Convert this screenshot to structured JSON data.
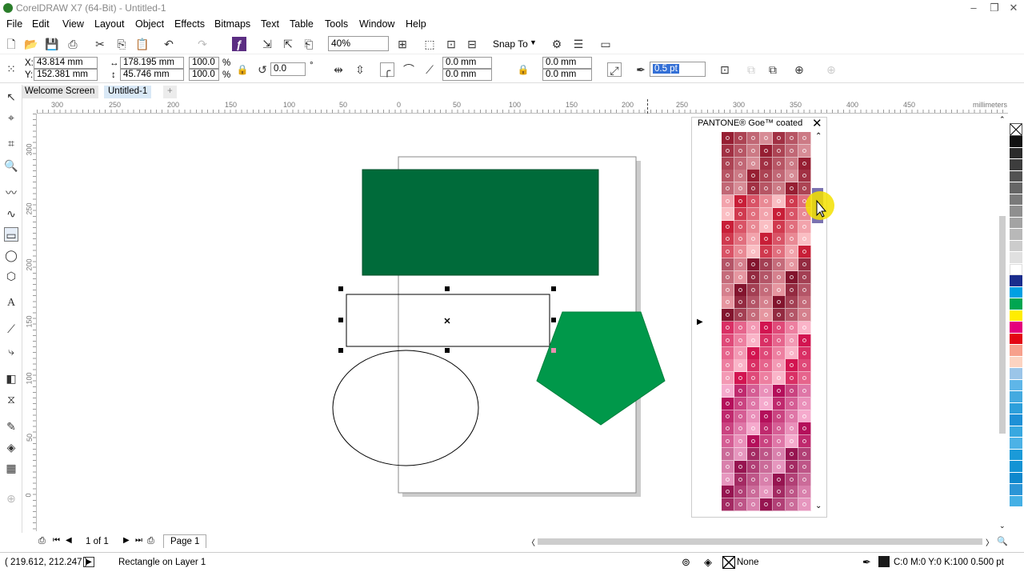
{
  "window": {
    "title": "CorelDRAW X7 (64-Bit) - Untitled-1"
  },
  "menu": [
    "File",
    "Edit",
    "View",
    "Layout",
    "Object",
    "Effects",
    "Bitmaps",
    "Text",
    "Table",
    "Tools",
    "Window",
    "Help"
  ],
  "toolbar": {
    "zoom": "40%",
    "snap_to": "Snap To"
  },
  "property_bar": {
    "x_label": "X:",
    "x": "43.814 mm",
    "y_label": "Y:",
    "y": "152.381 mm",
    "width": "178.195 mm",
    "height": "45.746 mm",
    "scale_x": "100.0",
    "scale_y": "100.0",
    "percent": "%",
    "rotation": "0.0",
    "degree": "°",
    "corner_tl": "0.0 mm",
    "corner_bl": "0.0 mm",
    "corner_tr": "0.0 mm",
    "corner_br": "0.0 mm",
    "outline_width": "0.5 pt"
  },
  "document_tabs": [
    "Welcome Screen",
    "Untitled-1"
  ],
  "rulers": {
    "unit": "millimeters",
    "h_ticks": [
      "300",
      "250",
      "200",
      "150",
      "100",
      "50",
      "0",
      "50",
      "100",
      "150",
      "200",
      "250",
      "300",
      "350",
      "400",
      "450"
    ],
    "v_ticks": [
      "300",
      "250",
      "200",
      "150",
      "100",
      "50",
      "0"
    ]
  },
  "pantone_palette": {
    "title": "PANTONE® Goe™ coated"
  },
  "page_nav": {
    "page_count": "1 of 1",
    "page_tab": "Page 1"
  },
  "status": {
    "coords": "( 219.612, 212.247 )",
    "object_info": "Rectangle on Layer 1",
    "fill_label": "None",
    "outline_info": "C:0 M:0 Y:0 K:100  0.500 pt"
  },
  "colors": {
    "green_rect": "#006b3a",
    "pentagon": "#00984a"
  }
}
